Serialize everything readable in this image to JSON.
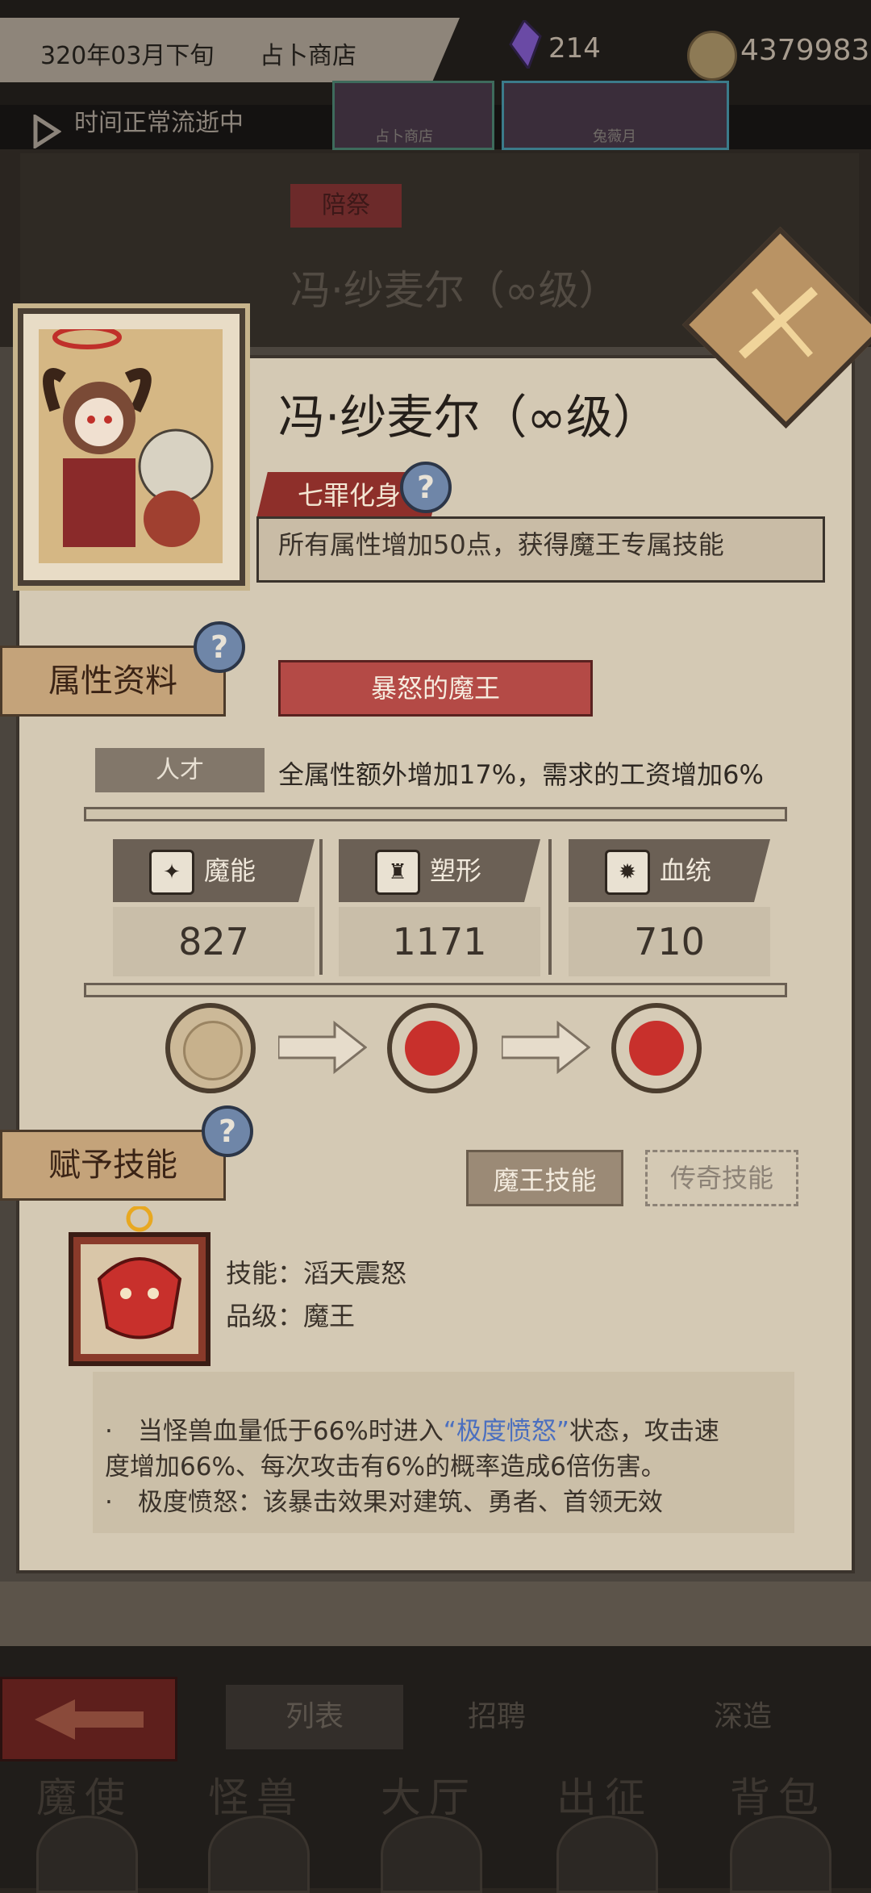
{
  "topbar": {
    "date": "320年03月下旬",
    "location": "占卜商店",
    "gems": "214",
    "gold": "4379983",
    "time_status": "时间正常流逝中",
    "mini_tabs": [
      "占卜商店",
      "兔薇月"
    ]
  },
  "dim_panel": {
    "tag": "陪祭",
    "name": "冯·纱麦尔（∞级）"
  },
  "character": {
    "name": "冯·纱麦尔（∞级）",
    "trait_title": "七罪化身",
    "trait_desc": "所有属性增加50点，获得魔王专属技能",
    "help_glyph": "?"
  },
  "attributes": {
    "section_label": "属性资料",
    "title": "暴怒的魔王",
    "talent_label": "人才",
    "talent_desc": "全属性额外增加17%，需求的工资增加6%",
    "stats": [
      {
        "label": "魔能",
        "value": "827",
        "icon": "magic-claw-icon"
      },
      {
        "label": "塑形",
        "value": "1171",
        "icon": "body-shape-icon"
      },
      {
        "label": "血统",
        "value": "710",
        "icon": "bloodline-gear-icon"
      }
    ]
  },
  "skill": {
    "section_label": "赋予技能",
    "demon_button": "魔王技能",
    "legend_button": "传奇技能",
    "name": "技能：滔天震怒",
    "grade": "品级：魔王",
    "desc_line1_pre": "·　当怪兽血量低于66%时进入",
    "desc_line1_hl": "“极度愤怒”",
    "desc_line1_post": "状态，攻击速",
    "desc_line2": "度增加66%、每次攻击有6%的概率造成6倍伤害。",
    "desc_line3": "·　极度愤怒：该暴击效果对建筑、勇者、首领无效"
  },
  "bottom": {
    "tabs": [
      "列表",
      "招聘",
      "深造"
    ],
    "nav": [
      "魔使",
      "怪兽",
      "大厅",
      "出征",
      "背包"
    ]
  }
}
